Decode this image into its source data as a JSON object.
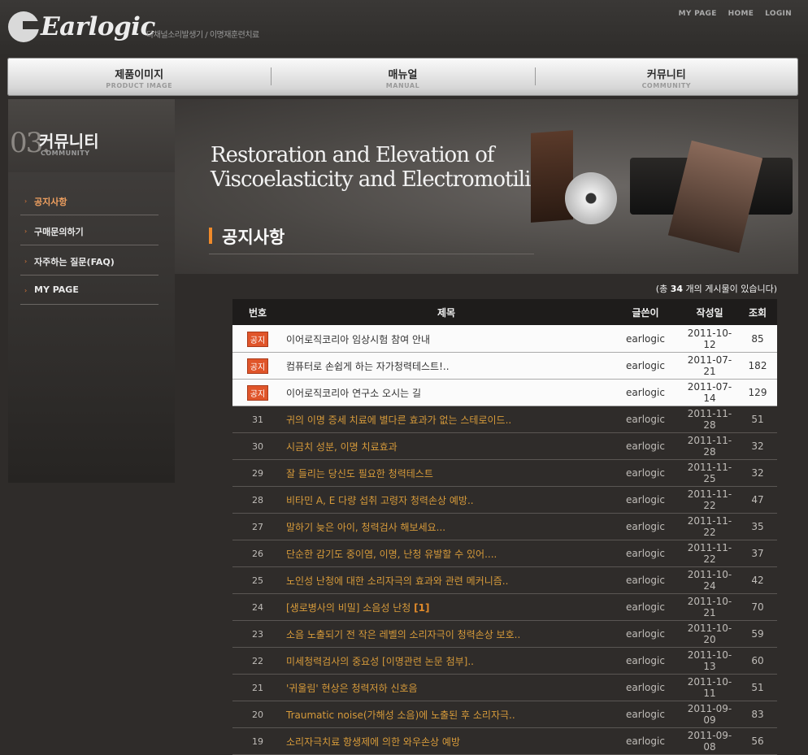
{
  "header": {
    "logo_text": "Earlogic",
    "tagline": "다채널소리발생기 / 이명재훈련치료",
    "top_links": [
      "MY PAGE",
      "HOME",
      "LOGIN"
    ]
  },
  "nav": [
    {
      "ko": "제품이미지",
      "en": "PRODUCT IMAGE"
    },
    {
      "ko": "매뉴얼",
      "en": "MANUAL"
    },
    {
      "ko": "커뮤니티",
      "en": "COMMUNITY"
    }
  ],
  "section": {
    "num": "03.",
    "title": "커뮤니티",
    "subtitle": "COMMUNITY"
  },
  "side_menu": [
    {
      "label": "공지사항",
      "active": true
    },
    {
      "label": "구매문의하기",
      "active": false
    },
    {
      "label": "자주하는 질문(FAQ)",
      "active": false
    },
    {
      "label": "MY PAGE",
      "active": false
    }
  ],
  "hero": {
    "line1": "Restoration and Elevation of",
    "line2": "Viscoelasticity and Electromotility"
  },
  "page_title": "공지사항",
  "count": {
    "prefix": "(총 ",
    "num": "34",
    "suffix": " 개의 게시물이 있습니다)"
  },
  "table": {
    "headers": [
      "번호",
      "제목",
      "글쓴이",
      "작성일",
      "조회"
    ],
    "notice_badge": "공지",
    "notices": [
      {
        "title": "이어로직코리아 임상시험 참여 안내",
        "author": "earlogic",
        "date": "2011-10-12",
        "views": "85"
      },
      {
        "title": "컴퓨터로 손쉽게 하는 자가청력테스트!..",
        "author": "earlogic",
        "date": "2011-07-21",
        "views": "182"
      },
      {
        "title": "이어로직코리아 연구소 오시는 길",
        "author": "earlogic",
        "date": "2011-07-14",
        "views": "129"
      }
    ],
    "posts": [
      {
        "no": "31",
        "title": "귀의 이명 증세 치료에 별다른 효과가 없는 스테로이드..",
        "author": "earlogic",
        "date": "2011-11-28",
        "views": "51"
      },
      {
        "no": "30",
        "title": "시금치 성분, 이명 치료효과",
        "author": "earlogic",
        "date": "2011-11-28",
        "views": "32"
      },
      {
        "no": "29",
        "title": "잘 들리는 당신도 필요한 청력테스트",
        "author": "earlogic",
        "date": "2011-11-25",
        "views": "32"
      },
      {
        "no": "28",
        "title": "비타민 A, E 다량 섭취 고령자 청력손상 예방..",
        "author": "earlogic",
        "date": "2011-11-22",
        "views": "47"
      },
      {
        "no": "27",
        "title": "말하기 늦은 아이, 청력검사 해보세요...",
        "author": "earlogic",
        "date": "2011-11-22",
        "views": "35"
      },
      {
        "no": "26",
        "title": "단순한 감기도 중이염, 이명, 난청 유발할 수 있어....",
        "author": "earlogic",
        "date": "2011-11-22",
        "views": "37"
      },
      {
        "no": "25",
        "title": "노인성 난청에 대한 소리자극의 효과와 관련 메커니즘..",
        "author": "earlogic",
        "date": "2011-10-24",
        "views": "42"
      },
      {
        "no": "24",
        "title": "[생로병사의 비밀] 소음성 난청",
        "reply": "[1]",
        "author": "earlogic",
        "date": "2011-10-21",
        "views": "70"
      },
      {
        "no": "23",
        "title": "소음 노출되기 전 작은 레벨의 소리자극이 청력손상 보호..",
        "author": "earlogic",
        "date": "2011-10-20",
        "views": "59"
      },
      {
        "no": "22",
        "title": "미세청력검사의 중요성 [이명관련 논문 첨부]..",
        "author": "earlogic",
        "date": "2011-10-13",
        "views": "60"
      },
      {
        "no": "21",
        "title": "'귀울림' 현상은 청력저하 신호음",
        "author": "earlogic",
        "date": "2011-10-11",
        "views": "51"
      },
      {
        "no": "20",
        "title": "Traumatic noise(가해성 소음)에 노출된 후 소리자극..",
        "author": "earlogic",
        "date": "2011-09-09",
        "views": "83"
      },
      {
        "no": "19",
        "title": "소리자극치료 항생제에 의한 와우손상 예방",
        "author": "earlogic",
        "date": "2011-09-08",
        "views": "56"
      }
    ]
  }
}
